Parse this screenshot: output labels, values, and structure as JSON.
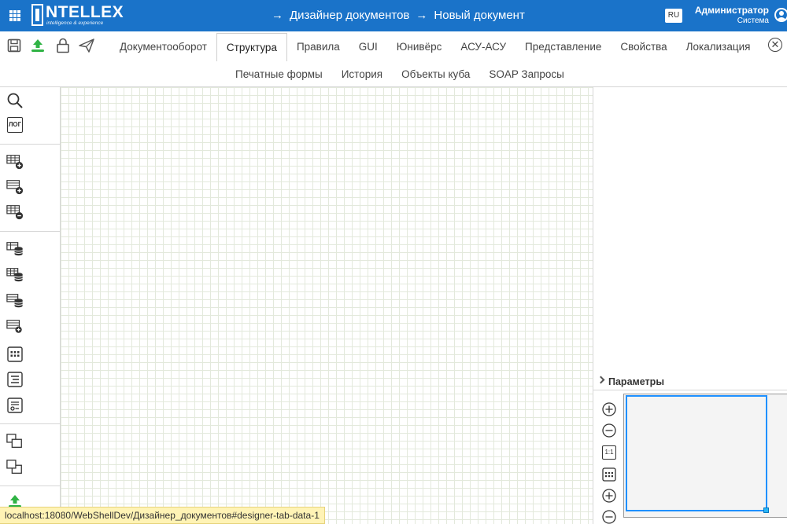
{
  "header": {
    "logo_text": "NTELLEX",
    "logo_sub": "intelligence & experience",
    "crumbs": [
      "Дизайнер документов",
      "Новый документ"
    ],
    "lang": "RU",
    "user_name": "Администратор",
    "user_role": "Система"
  },
  "toolbar": {
    "tabs_row1": [
      "Документооборот",
      "Структура",
      "Правила",
      "GUI",
      "Юнивёрс",
      "АСУ-АСУ",
      "Представление",
      "Свойства",
      "Локализация"
    ],
    "active_tab": "Структура",
    "tabs_row2": [
      "Печатные формы",
      "История",
      "Объекты куба",
      "SOAP Запросы"
    ]
  },
  "sidebar": {
    "log_label": "ЛОГ"
  },
  "right_panel": {
    "params_label": "Параметры",
    "zoom_reset_label": "1:1"
  },
  "status": {
    "url": "localhost:18080/WebShellDev/Дизайнер_документов#designer-tab-data-1"
  },
  "colors": {
    "header_bg": "#1a73c9",
    "accent": "#1e90ff",
    "upload_green": "#2fb344"
  }
}
